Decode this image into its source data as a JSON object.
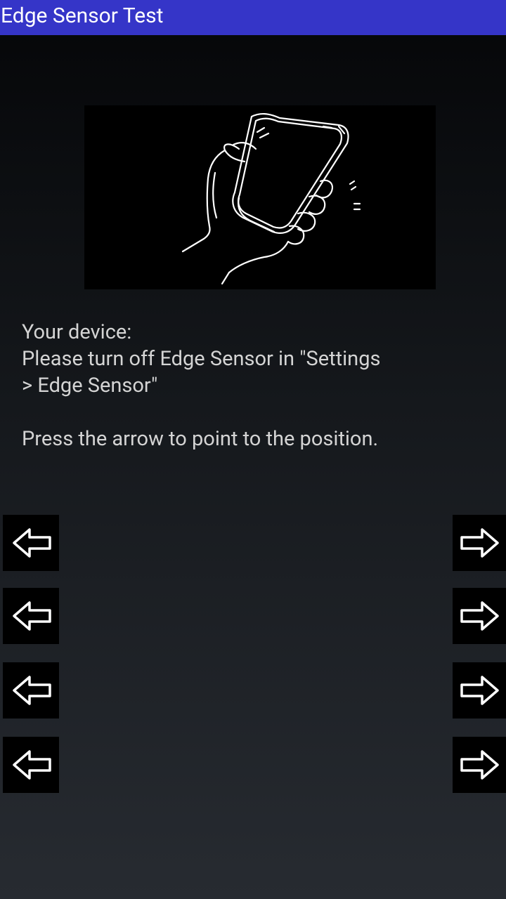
{
  "app_bar": {
    "title": "Edge Sensor Test",
    "color": "#3535c8"
  },
  "illustration": {
    "icon": "hand-holding-phone-icon"
  },
  "instructions": {
    "device_label": "Your device:",
    "message": "Please turn off Edge Sensor in \"Settings\n> Edge Sensor\"",
    "press_hint": "Press the arrow to point to the position."
  },
  "arrows": {
    "left_icon": "left-arrow-icon",
    "right_icon": "right-arrow-icon",
    "count_per_side": 4
  }
}
